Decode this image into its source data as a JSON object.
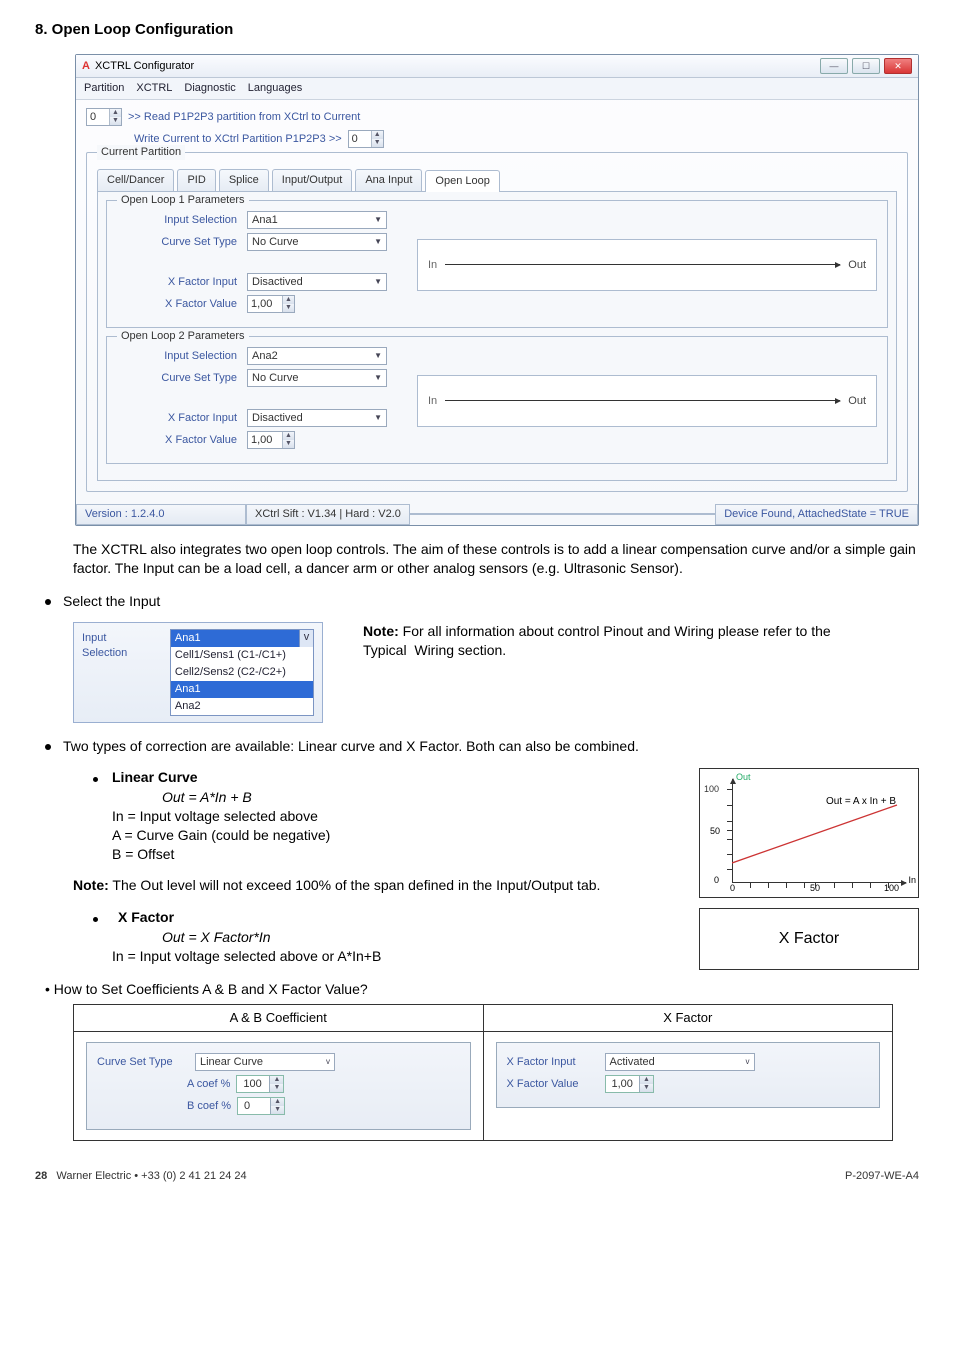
{
  "section_title": "8.  Open Loop Configuration",
  "window": {
    "title": "XCTRL Configurator",
    "icon_letter": "A",
    "menubar": [
      "Partition",
      "XCTRL",
      "Diagnostic",
      "Languages"
    ],
    "read_btn": ">> Read P1P2P3 partition from XCtrl to Current",
    "write_btn": "Write Current to XCtrl Partition P1P2P3 >>",
    "spin_read": "0",
    "spin_write": "0",
    "group_title": "Current Partition",
    "tabs": [
      "Cell/Dancer",
      "PID",
      "Splice",
      "Input/Output",
      "Ana Input",
      "Open Loop"
    ],
    "active_tab": 5,
    "loop1": {
      "title": "Open Loop 1 Parameters",
      "input_sel_lbl": "Input Selection",
      "input_sel_val": "Ana1",
      "curve_lbl": "Curve Set Type",
      "curve_val": "No Curve",
      "xfact_in_lbl": "X Factor Input",
      "xfact_in_val": "Disactived",
      "xfact_val_lbl": "X Factor Value",
      "xfact_val_val": "1,00",
      "in": "In",
      "out": "Out"
    },
    "loop2": {
      "title": "Open Loop 2 Parameters",
      "input_sel_lbl": "Input Selection",
      "input_sel_val": "Ana2",
      "curve_lbl": "Curve Set Type",
      "curve_val": "No Curve",
      "xfact_in_lbl": "X Factor Input",
      "xfact_in_val": "Disactived",
      "xfact_val_lbl": "X Factor Value",
      "xfact_val_val": "1,00",
      "in": "In",
      "out": "Out"
    },
    "status": {
      "version": "Version : 1.2.4.0",
      "middle": "XCtrl Sift : V1.34  |  Hard : V2.0",
      "device": "Device Found, AttachedState = TRUE"
    }
  },
  "para1": "The XCTRL also integrates two open loop controls. The aim of these controls is to add a linear compensation curve and/or a simple gain factor. The Input can be a load cell, a dancer arm or other analog sensors (e.g. Ultrasonic Sensor).",
  "bullet_select": "Select the Input",
  "inputsel": {
    "label": "Input Selection",
    "selected": "Ana1",
    "opts": [
      "Cell1/Sens1 (C1-/C1+)",
      "Cell2/Sens2 (C2-/C2+)",
      "Ana1",
      "Ana2"
    ]
  },
  "note1": "Note: For all information about control Pinout and Wiring please refer to the Typical  Wiring section.",
  "note1_label": "Note:",
  "bullet_twotypes": "Two types of correction are available: Linear curve and X Factor. Both can also be combined.",
  "linear": {
    "title": "Linear Curve",
    "eq": "Out = A*In + B",
    "l1": "In = Input voltage selected above",
    "l2": "A = Curve Gain (could be negative)",
    "l3": "B = Offset"
  },
  "note2": "Note: The Out level will not exceed 100% of the span defined in the Input/Output tab.",
  "note2_label": "Note:",
  "note2_body": " The Out level will not exceed 100% of the span defined in the Input/Output tab.",
  "xfactor": {
    "title": "X Factor",
    "eq": "Out = X Factor*In",
    "l1": "In = Input voltage selected above or A*In+B",
    "box": "X Factor"
  },
  "howto": "• How to Set Coefficients A & B and X Factor Value?",
  "table": {
    "h1": "A & B Coefficient",
    "h2": "X Factor",
    "curve_lbl": "Curve Set Type",
    "curve_val": "Linear Curve",
    "acoef_lbl": "A coef   %",
    "acoef_val": "100",
    "bcoef_lbl": "B coef   %",
    "bcoef_val": "0",
    "xfi_lbl": "X Factor Input",
    "xfi_val": "Activated",
    "xfv_lbl": "X Factor Value",
    "xfv_val": "1,00"
  },
  "chart_data": {
    "type": "line",
    "title": "",
    "xlabel": "In",
    "ylabel": "Out",
    "xlim": [
      0,
      100
    ],
    "ylim": [
      0,
      100
    ],
    "x_ticks": [
      0,
      50,
      100
    ],
    "y_ticks": [
      0,
      50,
      100
    ],
    "annotation": "Out = A x In + B",
    "series": [
      {
        "name": "line",
        "x": [
          0,
          100
        ],
        "y": [
          20,
          75
        ]
      }
    ]
  },
  "footer": {
    "left": "28   Warner Electric • +33 (0) 2 41 21 24 24",
    "right": "P-2097-WE-A4"
  }
}
